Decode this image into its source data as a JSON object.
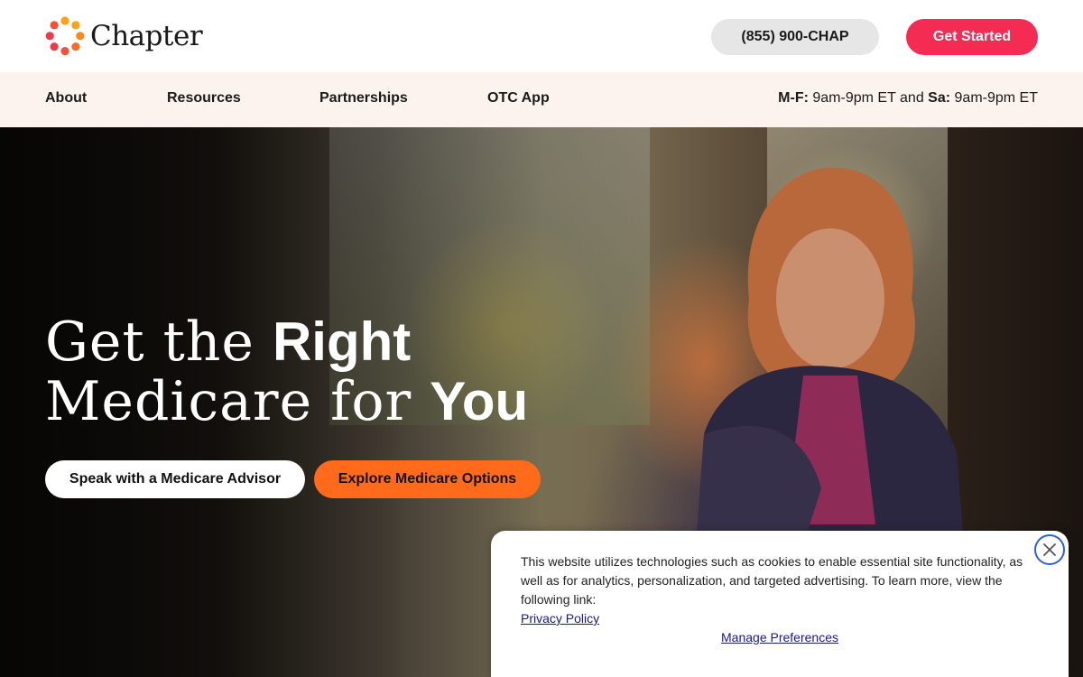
{
  "header": {
    "logo_text": "Chapter",
    "logo_icon": "chapter-dot-ring-icon",
    "phone_label": "(855) 900-CHAP",
    "cta_label": "Get Started",
    "colors": {
      "cta": "#f42c54",
      "phone_bg": "#e6e6e6"
    }
  },
  "nav": {
    "items": [
      {
        "label": "About"
      },
      {
        "label": "Resources"
      },
      {
        "label": "Partnerships"
      },
      {
        "label": "OTC App"
      }
    ],
    "hours": {
      "weekday_label": "M-F:",
      "weekday_hours": "9am-9pm ET",
      "joiner": "and",
      "saturday_label": "Sa:",
      "saturday_hours": "9am-9pm ET"
    },
    "background": "#fdf3ee"
  },
  "hero": {
    "line1_light": "Get the",
    "line1_bold": "Right",
    "line2_light": "Medicare for",
    "line2_bold": "You",
    "advisor_button": "Speak with a Medicare Advisor",
    "explore_button": "Explore Medicare Options",
    "colors": {
      "explore": "#ff6b1a"
    }
  },
  "cookie_banner": {
    "text": "This website utilizes technologies such as cookies to enable essential site functionality, as well as for analytics, personalization, and targeted advertising. To learn more, view the following link:",
    "privacy_link": "Privacy Policy",
    "manage_link": "Manage Preferences",
    "close_icon": "close-icon"
  }
}
